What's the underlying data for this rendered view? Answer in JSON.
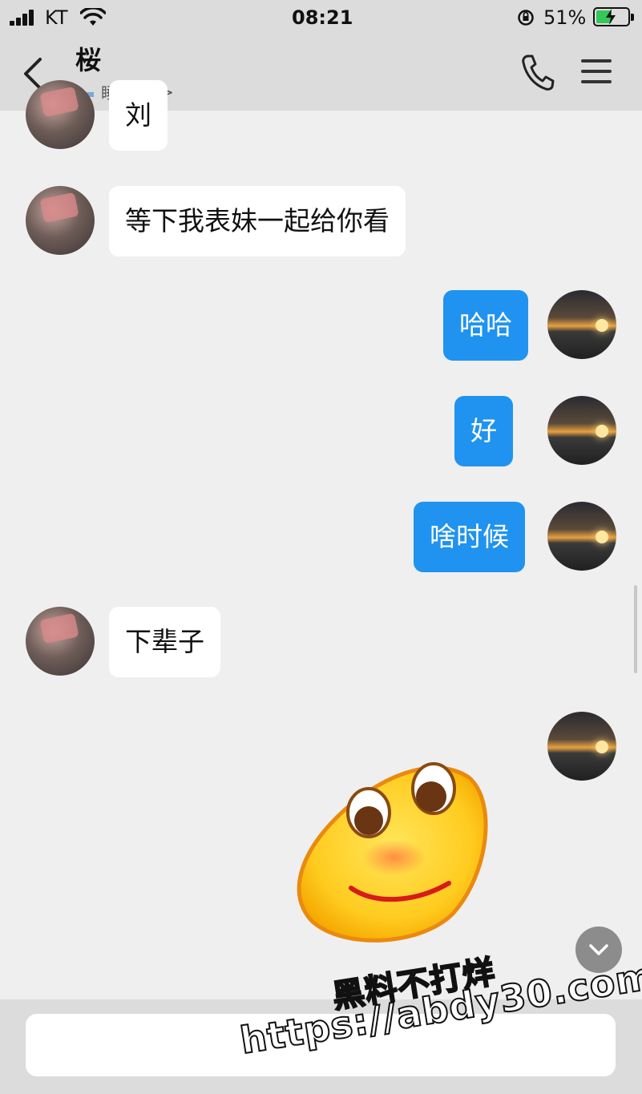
{
  "status_bar": {
    "carrier": "KT",
    "time": "08:21",
    "battery_percent": "51%",
    "battery_level": 0.51
  },
  "header": {
    "contact_name": "桜",
    "presence_status": "睡觉中",
    "presence_chevron": ">"
  },
  "messages": [
    {
      "sender": "friend",
      "text": "刘"
    },
    {
      "sender": "friend",
      "text": "等下我表妹一起给你看"
    },
    {
      "sender": "me",
      "text": "哈哈"
    },
    {
      "sender": "me",
      "text": "好"
    },
    {
      "sender": "me",
      "text": "啥时候"
    },
    {
      "sender": "friend",
      "text": "下辈子"
    },
    {
      "sender": "me",
      "type": "sticker",
      "icon": "smiley-sticker"
    }
  ],
  "input": {
    "placeholder": ""
  },
  "watermark": {
    "line1": "黑料不打烊",
    "line2": "https://abdy30.com"
  },
  "colors": {
    "outgoing_bubble": "#1f93ef",
    "incoming_bubble": "#ffffff",
    "chat_background": "#efefef",
    "bar_background": "#dcdcdc"
  }
}
